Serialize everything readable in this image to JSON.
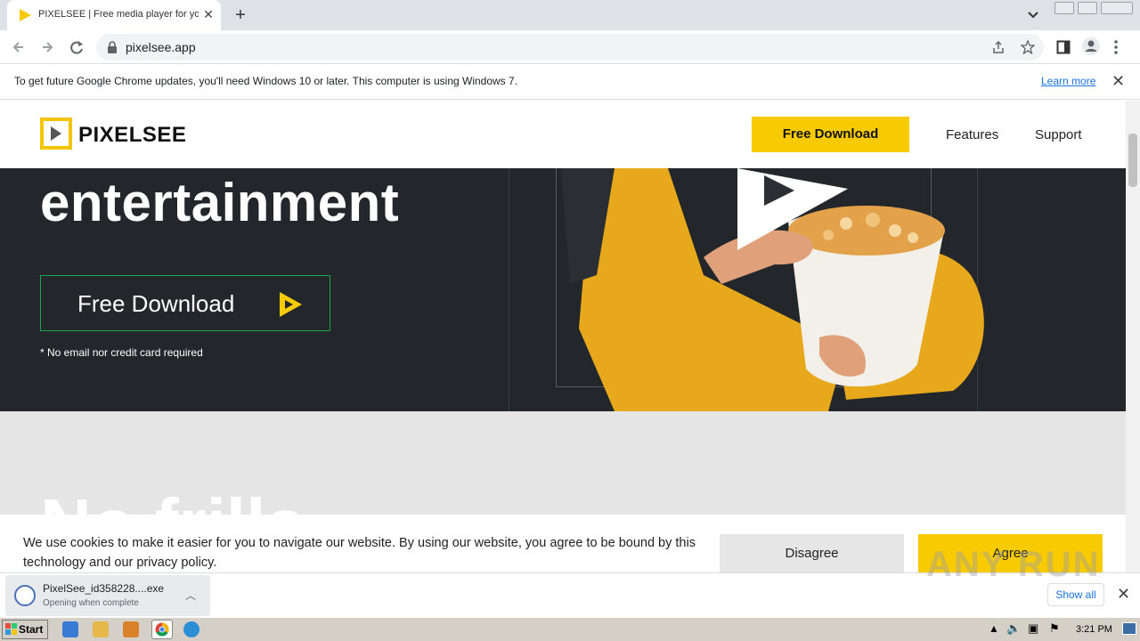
{
  "browser": {
    "tab_title": "PIXELSEE | Free media player for your",
    "url": "pixelsee.app"
  },
  "infobar": {
    "message": "To get future Google Chrome updates, you'll need Windows 10 or later. This computer is using Windows 7.",
    "learn_more": "Learn more"
  },
  "site": {
    "logo": "PIXELSEE",
    "header_download": "Free Download",
    "nav": [
      "Features",
      "Support"
    ],
    "hero_headline": "entertainment",
    "hero_download": "Free Download",
    "hero_note": "* No email nor credit card required",
    "section_heading": "No frills"
  },
  "cookie": {
    "text": "We use cookies to make it easier for you to navigate our website. By using our website, you agree to be bound by this technology and our privacy policy.",
    "disagree": "Disagree",
    "agree": "Agree"
  },
  "download_shelf": {
    "filename": "PixelSee_id358228....exe",
    "status": "Opening when complete",
    "show_all": "Show all"
  },
  "watermark": "ANY RUN",
  "taskbar": {
    "start": "Start",
    "clock": "3:21 PM"
  },
  "colors": {
    "brand_yellow": "#f7cb00",
    "hero_bg": "#23272b",
    "hero_border": "#1fa24a"
  }
}
